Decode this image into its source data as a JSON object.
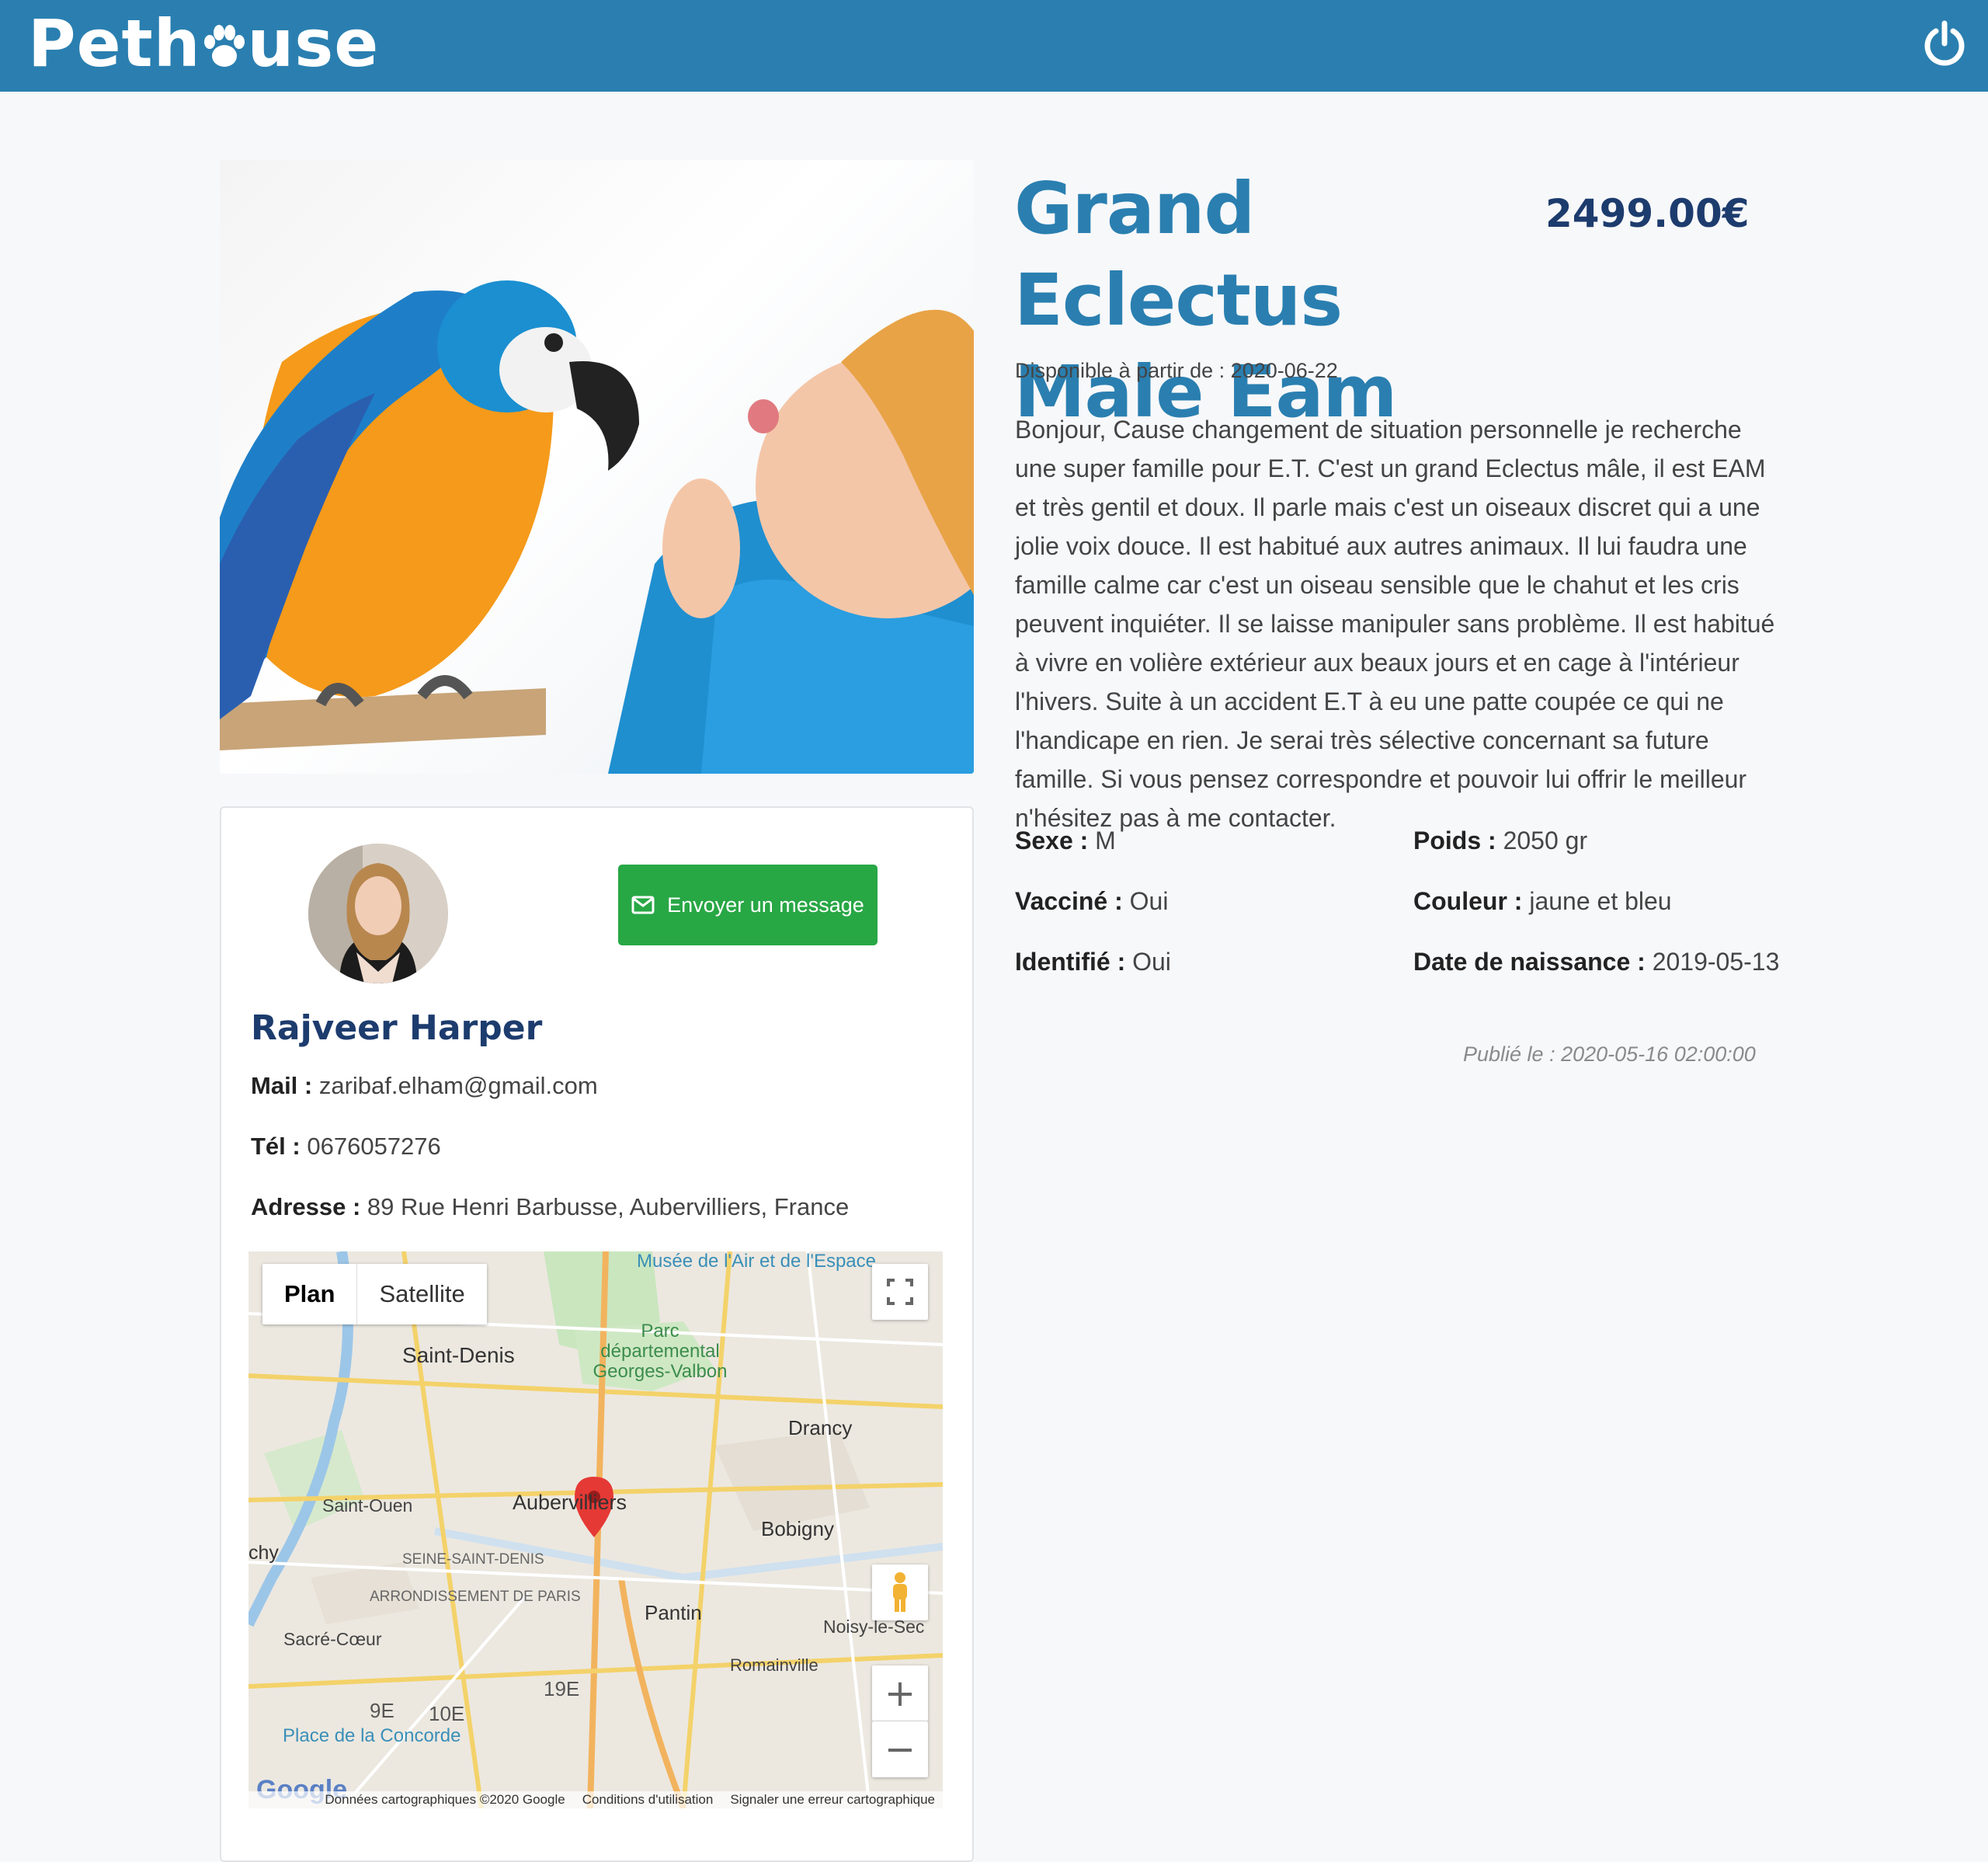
{
  "header": {
    "logo": "Pethouse",
    "brand_color": "#2a7fb0"
  },
  "listing": {
    "title": "Grand Eclectus Male Eam",
    "price": "2499.00€",
    "available_label": "Disponible à partir de :",
    "available_date": "2020-06-22",
    "description": "Bonjour, Cause changement de situation personnelle je recherche une super famille pour E.T. C'est un grand Eclectus mâle, il est EAM et très gentil et doux. Il parle mais c'est un oiseaux discret qui a une jolie voix douce. Il est habitué aux autres animaux. Il lui faudra une famille calme car c'est un oiseau sensible que le chahut et les cris peuvent inquiéter. Il se laisse manipuler sans problème. Il est habitué à vivre en volière extérieur aux beaux jours et en cage à l'intérieur l'hivers. Suite à un accident E.T à eu une patte coupée ce qui ne l'handicape en rien. Je serai très sélective concernant sa future famille. Si vous pensez correspondre et pouvoir lui offrir le meilleur n'hésitez pas à me contacter.",
    "attributes": {
      "sexe_label": "Sexe :",
      "sexe_value": "M",
      "poids_label": "Poids :",
      "poids_value": "2050 gr",
      "vaccine_label": "Vacciné :",
      "vaccine_value": "Oui",
      "couleur_label": "Couleur :",
      "couleur_value": "jaune et bleu",
      "identifie_label": "Identifié :",
      "identifie_value": "Oui",
      "naissance_label": "Date de naissance :",
      "naissance_value": "2019-05-13"
    },
    "published": "Publié le : 2020-05-16 02:00:00"
  },
  "seller": {
    "name": "Rajveer Harper",
    "message_button": "Envoyer un message",
    "mail_label": "Mail :",
    "mail_value": "zaribaf.elham@gmail.com",
    "tel_label": "Tél :",
    "tel_value": "0676057276",
    "address_label": "Adresse :",
    "address_value": "89 Rue Henri Barbusse, Aubervilliers, France"
  },
  "map": {
    "tab_plan": "Plan",
    "tab_satellite": "Satellite",
    "google": "Google",
    "footer_data": "Données cartographiques ©2020 Google",
    "footer_terms": "Conditions d'utilisation",
    "footer_report": "Signaler une erreur cartographique",
    "labels": {
      "museum": "Musée de l'Air et de l'Espace",
      "parc": "Parc départemental Georges-Valbon",
      "saint_denis": "Saint-Denis",
      "drancy": "Drancy",
      "saint_ouen": "Saint-Ouen",
      "aubervilliers": "Aubervilliers",
      "bobigny": "Bobigny",
      "seine": "SEINE-SAINT-DENIS",
      "arrondissement": "ARRONDISSEMENT DE PARIS",
      "pantin": "Pantin",
      "noisy": "Noisy-le-Sec",
      "sacre": "Sacré-Cœur",
      "romainville": "Romainville",
      "e19": "19E",
      "e9": "9E",
      "e10": "10E",
      "concorde": "Place de la Concorde",
      "chy": "chy"
    }
  }
}
